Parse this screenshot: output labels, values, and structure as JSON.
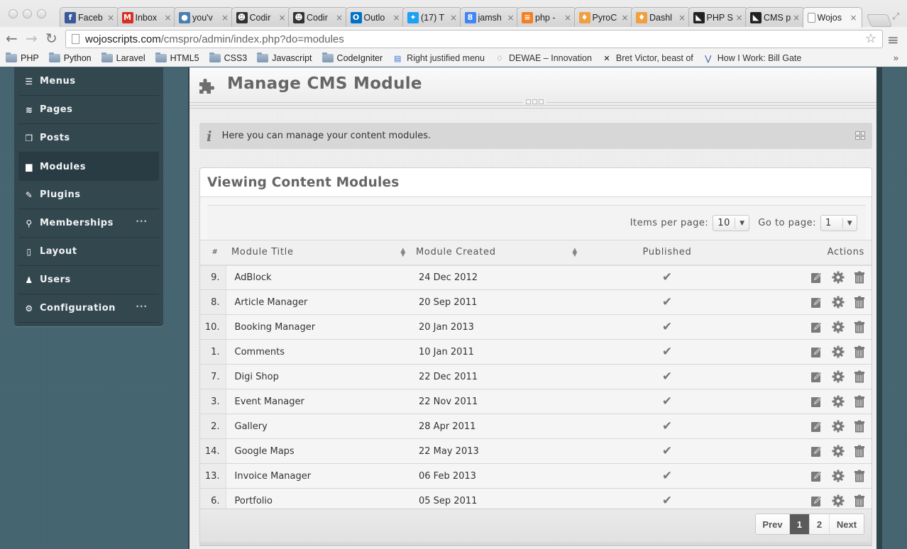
{
  "browser": {
    "tabs": [
      {
        "title": "Faceb",
        "icon": "facebook-icon",
        "color": "#3b5998",
        "glyph": "f"
      },
      {
        "title": "Inbox",
        "icon": "gmail-icon",
        "color": "#d93025",
        "glyph": "M"
      },
      {
        "title": "you'v",
        "icon": "globe-icon",
        "color": "#4a7fb0",
        "glyph": "●"
      },
      {
        "title": "Codir",
        "icon": "avatar-icon",
        "color": "#333333",
        "glyph": "☻"
      },
      {
        "title": "Codir",
        "icon": "avatar-icon",
        "color": "#333333",
        "glyph": "☻"
      },
      {
        "title": "Outlo",
        "icon": "outlook-icon",
        "color": "#0072c6",
        "glyph": "O"
      },
      {
        "title": "(17) T",
        "icon": "twitter-icon",
        "color": "#1da1f2",
        "glyph": "✦"
      },
      {
        "title": "jamsh",
        "icon": "google-icon",
        "color": "#4285f4",
        "glyph": "8"
      },
      {
        "title": "php -",
        "icon": "stackoverflow-icon",
        "color": "#f48024",
        "glyph": "≡"
      },
      {
        "title": "PyroC",
        "icon": "flame-icon",
        "color": "#f0a040",
        "glyph": "♦"
      },
      {
        "title": "Dashl",
        "icon": "flame-icon",
        "color": "#f0a040",
        "glyph": "♦"
      },
      {
        "title": "PHP S",
        "icon": "penguin-icon",
        "color": "#222222",
        "glyph": "◣"
      },
      {
        "title": "CMS p",
        "icon": "penguin-icon",
        "color": "#222222",
        "glyph": "◣"
      },
      {
        "title": "Wojos",
        "icon": "page-icon",
        "color": "#ffffff",
        "glyph": "▯",
        "active": true
      }
    ],
    "url_host": "wojoscripts.com",
    "url_path": "/cmspro/admin/index.php?do=modules",
    "bookmarks": [
      {
        "label": "PHP",
        "type": "folder"
      },
      {
        "label": "Python",
        "type": "folder"
      },
      {
        "label": "Laravel",
        "type": "folder"
      },
      {
        "label": "HTML5",
        "type": "folder"
      },
      {
        "label": "CSS3",
        "type": "folder"
      },
      {
        "label": "Javascript",
        "type": "folder"
      },
      {
        "label": "CodeIgniter",
        "type": "folder"
      },
      {
        "label": "Right justified menu",
        "type": "link",
        "icon": "menu-bookmark-icon"
      },
      {
        "label": "DEWAE – Innovation",
        "type": "link",
        "icon": "dewae-icon"
      },
      {
        "label": "Bret Victor, beast of",
        "type": "link",
        "icon": "windmill-icon"
      },
      {
        "label": "How I Work: Bill Gate",
        "type": "link",
        "icon": "lifehacker-icon"
      }
    ],
    "bookmarks_more": "»"
  },
  "sidebar": {
    "items": [
      {
        "label": "Menus",
        "icon": "menu-list-icon",
        "glyph": "☰"
      },
      {
        "label": "Pages",
        "icon": "stack-icon",
        "glyph": "≋"
      },
      {
        "label": "Posts",
        "icon": "windows-icon",
        "glyph": "❐"
      },
      {
        "label": "Modules",
        "icon": "calendar-icon",
        "glyph": "▆",
        "active": true
      },
      {
        "label": "Plugins",
        "icon": "paperclip-icon",
        "glyph": "✎"
      },
      {
        "label": "Memberships",
        "icon": "key-icon",
        "glyph": "⚲",
        "more": "···"
      },
      {
        "label": "Layout",
        "icon": "mobile-icon",
        "glyph": "▯"
      },
      {
        "label": "Users",
        "icon": "user-icon",
        "glyph": "♟"
      },
      {
        "label": "Configuration",
        "icon": "gear-icon",
        "glyph": "⚙",
        "more": "···"
      }
    ]
  },
  "header": {
    "title": "Manage CMS Module"
  },
  "info": {
    "text": "Here you can manage your content modules."
  },
  "panel": {
    "title": "Viewing Content Modules",
    "items_per_page_label": "Items per page:",
    "items_per_page_value": "10",
    "go_to_page_label": "Go to page:",
    "go_to_page_value": "1",
    "columns": [
      "#",
      "Module Title",
      "Module Created",
      "Published",
      "Actions"
    ],
    "rows": [
      {
        "num": "9.",
        "title": "AdBlock",
        "created": "24 Dec 2012",
        "published": true
      },
      {
        "num": "8.",
        "title": "Article Manager",
        "created": "20 Sep 2011",
        "published": true
      },
      {
        "num": "10.",
        "title": "Booking Manager",
        "created": "20 Jan 2013",
        "published": true
      },
      {
        "num": "1.",
        "title": "Comments",
        "created": "10 Jan 2011",
        "published": true
      },
      {
        "num": "7.",
        "title": "Digi Shop",
        "created": "22 Dec 2011",
        "published": true
      },
      {
        "num": "3.",
        "title": "Event Manager",
        "created": "22 Nov 2011",
        "published": true
      },
      {
        "num": "2.",
        "title": "Gallery",
        "created": "28 Apr 2011",
        "published": true
      },
      {
        "num": "14.",
        "title": "Google Maps",
        "created": "22 May 2013",
        "published": true
      },
      {
        "num": "13.",
        "title": "Invoice Manager",
        "created": "06 Feb 2013",
        "published": true
      },
      {
        "num": "6.",
        "title": "Portfolio",
        "created": "05 Sep 2011",
        "published": true
      }
    ],
    "check_glyph": "✔",
    "pagination": {
      "prev": "Prev",
      "pages": [
        "1",
        "2"
      ],
      "current": "1",
      "next": "Next"
    }
  },
  "colors": {
    "sidebar_bg": "#33474f",
    "page_bg": "#456570",
    "icon_gray": "#777777",
    "active_page": "#5a5a5a"
  }
}
